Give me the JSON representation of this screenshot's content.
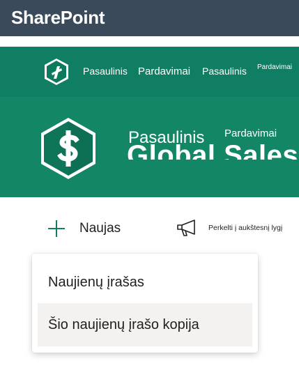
{
  "suite_bar": {
    "title": "SharePoint",
    "background": "#3b4a5a"
  },
  "hub_nav": {
    "background": "#107e62",
    "logo_icon": "sharepoint-hub-logo-icon",
    "items": [
      {
        "label": "Pasaulinis"
      },
      {
        "label": "Pardavimai"
      },
      {
        "label": "Pasaulinis"
      },
      {
        "label": "Pardavimai"
      }
    ]
  },
  "site_header": {
    "background": "#138765",
    "logo_icon": "dollar-sign-icon",
    "title_en": "Global Sales",
    "title_part1": "Pasaulinis",
    "title_part2": "Pardavimai"
  },
  "command_bar": {
    "new_label": "Naujas",
    "new_icon": "plus-icon",
    "promote_label": "Perkelti į aukštesnį lygį",
    "promote_icon": "megaphone-icon",
    "accent": "#107e62"
  },
  "new_menu": {
    "items": [
      {
        "label": "Naujienų įrašas"
      },
      {
        "label": "Šio naujienų įrašo kopija"
      }
    ],
    "hover_background": "#f3f2f1"
  }
}
